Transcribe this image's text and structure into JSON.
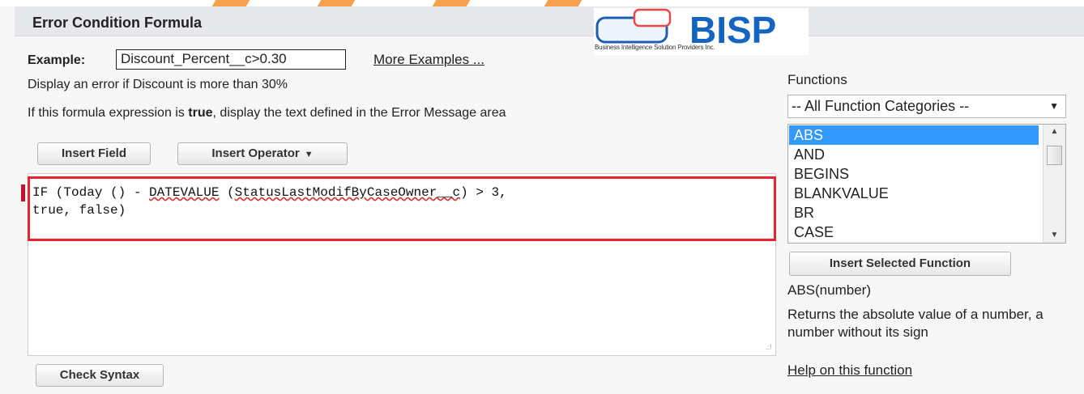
{
  "header": {
    "title": "Error Condition Formula"
  },
  "logo": {
    "text": "BISP",
    "tagline": "Business Intelligence Solution Providers Inc."
  },
  "example": {
    "label": "Example:",
    "formula": "Discount_Percent__c>0.30",
    "more_link": "More Examples ...",
    "description": "Display an error if Discount is more than 30%"
  },
  "instructions": {
    "before": "If this formula expression is ",
    "bold": "true",
    "after": ", display the text defined in the Error Message area"
  },
  "toolbar": {
    "insert_field": "Insert Field",
    "insert_operator": "Insert Operator"
  },
  "editor": {
    "line1_a": "IF (Today () - ",
    "line1_b": "DATEVALUE",
    "line1_c": " (",
    "line1_d": "StatusLastModifByCaseOwner__c",
    "line1_e": ") > 3,",
    "line2": "true, false)"
  },
  "check_syntax": "Check Syntax",
  "functions": {
    "label": "Functions",
    "category": "-- All Function Categories --",
    "items": [
      "ABS",
      "AND",
      "BEGINS",
      "BLANKVALUE",
      "BR",
      "CASE"
    ],
    "selected_index": 0,
    "insert_button": "Insert Selected Function",
    "signature": "ABS(number)",
    "description": "Returns the absolute value of a number, a number without its sign",
    "help_link": "Help on this function"
  },
  "colors": {
    "accent_orange": "#f6a04d",
    "logo_blue": "#1565c0",
    "highlight_red": "#e8242f",
    "selection_blue": "#3399ff"
  },
  "icons": [
    "dropdown-caret-icon",
    "scroll-up-arrow-icon",
    "scroll-down-arrow-icon",
    "resize-grip-icon"
  ]
}
